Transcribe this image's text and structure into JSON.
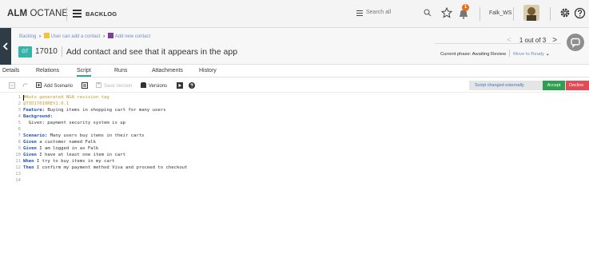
{
  "app": {
    "brand_bold": "ALM",
    "brand_rest": " OCTANE",
    "module": "BACKLOG",
    "search_placeholder": "Search all",
    "notification_count": "1",
    "username": "Falk_WS"
  },
  "breadcrumb": {
    "root": "Backlog",
    "story": "User can add a contact",
    "subitem": "Add new contact",
    "separator": "›"
  },
  "entity": {
    "type_badge": "GT",
    "id": "17010",
    "title": "Add contact and see that it appears in the app",
    "pager_text": "1 out of 3",
    "phase_text": "Current phase: Awaiting Review",
    "move_label": "Move to Ready",
    "move_caret": "⌄"
  },
  "tabs": [
    {
      "label": "Details",
      "active": false
    },
    {
      "label": "Relations",
      "active": false
    },
    {
      "label": "Script",
      "active": true
    },
    {
      "label": "Runs",
      "active": false
    },
    {
      "label": "Attachments",
      "active": false
    },
    {
      "label": "History",
      "active": false
    }
  ],
  "toolbar": {
    "add_scenario": "Add Scenario",
    "save_version": "Save Version",
    "versions": "Versions",
    "status_text": "Script changed externally",
    "accept": "Accept",
    "decline": "Decline"
  },
  "script": {
    "lines": [
      {
        "n": "1",
        "parts": [
          {
            "t": "#Auto generated NGA revision tag",
            "c": "comment"
          }
        ]
      },
      {
        "n": "2",
        "parts": [
          {
            "t": "@TID17010REV1.0.1",
            "c": "tag"
          }
        ]
      },
      {
        "n": "3",
        "parts": [
          {
            "t": "Feature:",
            "c": "kw"
          },
          {
            "t": " Buying items in shopping cart for many users",
            "c": ""
          }
        ]
      },
      {
        "n": "4",
        "parts": [
          {
            "t": "Background:",
            "c": "kw"
          }
        ]
      },
      {
        "n": "5",
        "parts": [
          {
            "t": "  Given: payment security system is up",
            "c": ""
          }
        ]
      },
      {
        "n": "6",
        "parts": []
      },
      {
        "n": "7",
        "parts": [
          {
            "t": "Scenario:",
            "c": "kw"
          },
          {
            "t": " Many users buy items in their carts",
            "c": ""
          }
        ]
      },
      {
        "n": "8",
        "parts": [
          {
            "t": "Given",
            "c": "kw"
          },
          {
            "t": " a customer named Falk",
            "c": ""
          }
        ]
      },
      {
        "n": "9",
        "parts": [
          {
            "t": "Given",
            "c": "kw"
          },
          {
            "t": " I am logged in as Falk",
            "c": ""
          }
        ]
      },
      {
        "n": "10",
        "parts": [
          {
            "t": "Given",
            "c": "kw"
          },
          {
            "t": " I have at least one item in cart",
            "c": ""
          }
        ]
      },
      {
        "n": "11",
        "parts": [
          {
            "t": "When",
            "c": "kw"
          },
          {
            "t": " I try to buy items in my cart",
            "c": ""
          }
        ]
      },
      {
        "n": "12",
        "parts": [
          {
            "t": "Then",
            "c": "kw"
          },
          {
            "t": " I confirm my payment method Visa and proceed to checkout",
            "c": ""
          }
        ]
      },
      {
        "n": "13",
        "parts": []
      },
      {
        "n": "14",
        "parts": []
      }
    ]
  },
  "colors": {
    "accent": "#2ba9a1",
    "keyword": "#1f4fb8",
    "comment": "#c99a2e",
    "accept": "#2e9e4f",
    "decline": "#e14c54",
    "link": "#6e90c0"
  },
  "icons": [
    "hamburger-icon",
    "search-icon",
    "star-icon",
    "notification-icon",
    "gear-icon",
    "help-icon",
    "chevron-left-icon",
    "chevron-right-icon",
    "comment-icon",
    "undo-icon",
    "redo-icon",
    "add-scenario-icon",
    "save-icon",
    "versions-icon",
    "run-icon",
    "help-circle-icon"
  ]
}
